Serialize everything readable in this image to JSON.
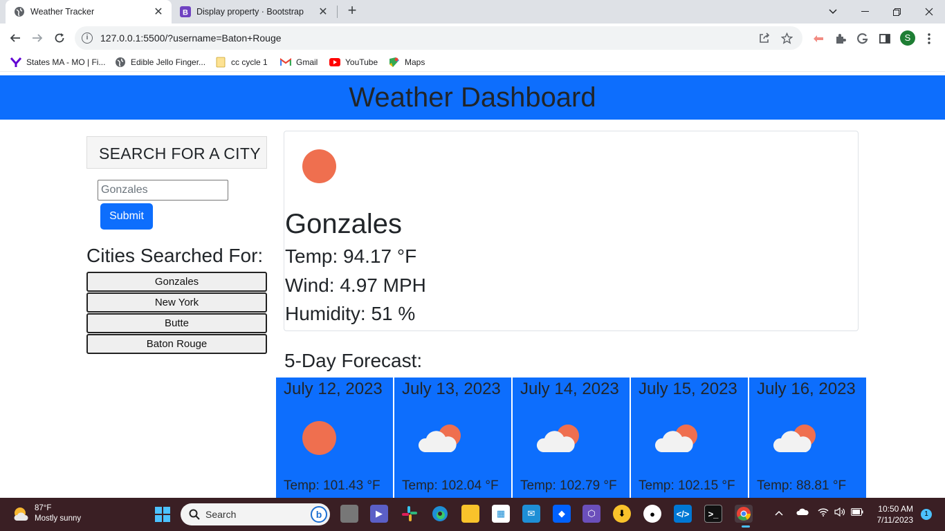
{
  "browser": {
    "tabs": [
      {
        "title": "Weather Tracker",
        "active": true
      },
      {
        "title": "Display property · Bootstrap",
        "active": false
      }
    ],
    "url": "127.0.0.1:5500/?username=Baton+Rouge",
    "profile_initial": "S",
    "bookmarks": [
      {
        "label": "States MA - MO | Fi...",
        "icon": "yahoo-icon"
      },
      {
        "label": "Edible Jello Finger...",
        "icon": "globe-icon"
      },
      {
        "label": "cc cycle 1",
        "icon": "folder-icon"
      },
      {
        "label": "Gmail",
        "icon": "gmail-icon"
      },
      {
        "label": "YouTube",
        "icon": "youtube-icon"
      },
      {
        "label": "Maps",
        "icon": "maps-icon"
      }
    ]
  },
  "page": {
    "header_title": "Weather Dashboard",
    "search": {
      "heading": "SEARCH FOR A CITY",
      "input_value": "Gonzales",
      "submit_label": "Submit"
    },
    "history": {
      "title": "Cities Searched For:",
      "cities": [
        "Gonzales",
        "New York",
        "Butte",
        "Baton Rouge"
      ]
    },
    "current": {
      "icon": "sun-icon",
      "city": "Gonzales",
      "temp": "Temp: 94.17 °F",
      "wind": "Wind: 4.97 MPH",
      "humidity": "Humidity: 51 %"
    },
    "forecast": {
      "title": "5-Day Forecast:",
      "days": [
        {
          "date": "July 12, 2023",
          "icon": "sun-icon",
          "temp": "Temp: 101.43 °F"
        },
        {
          "date": "July 13, 2023",
          "icon": "cloud-sun-icon",
          "temp": "Temp: 102.04 °F"
        },
        {
          "date": "July 14, 2023",
          "icon": "cloud-sun-icon",
          "temp": "Temp: 102.79 °F"
        },
        {
          "date": "July 15, 2023",
          "icon": "cloud-sun-icon",
          "temp": "Temp: 102.15 °F"
        },
        {
          "date": "July 16, 2023",
          "icon": "cloud-sun-icon",
          "temp": "Temp: 88.81 °F"
        }
      ]
    }
  },
  "taskbar": {
    "weather_temp": "87°F",
    "weather_desc": "Mostly sunny",
    "search_label": "Search",
    "time": "10:50 AM",
    "date": "7/11/2023",
    "notification_count": "1"
  },
  "colors": {
    "header_blue": "#0d6efd",
    "sun": "#ef6f4f",
    "taskbar": "#3a1f24"
  }
}
